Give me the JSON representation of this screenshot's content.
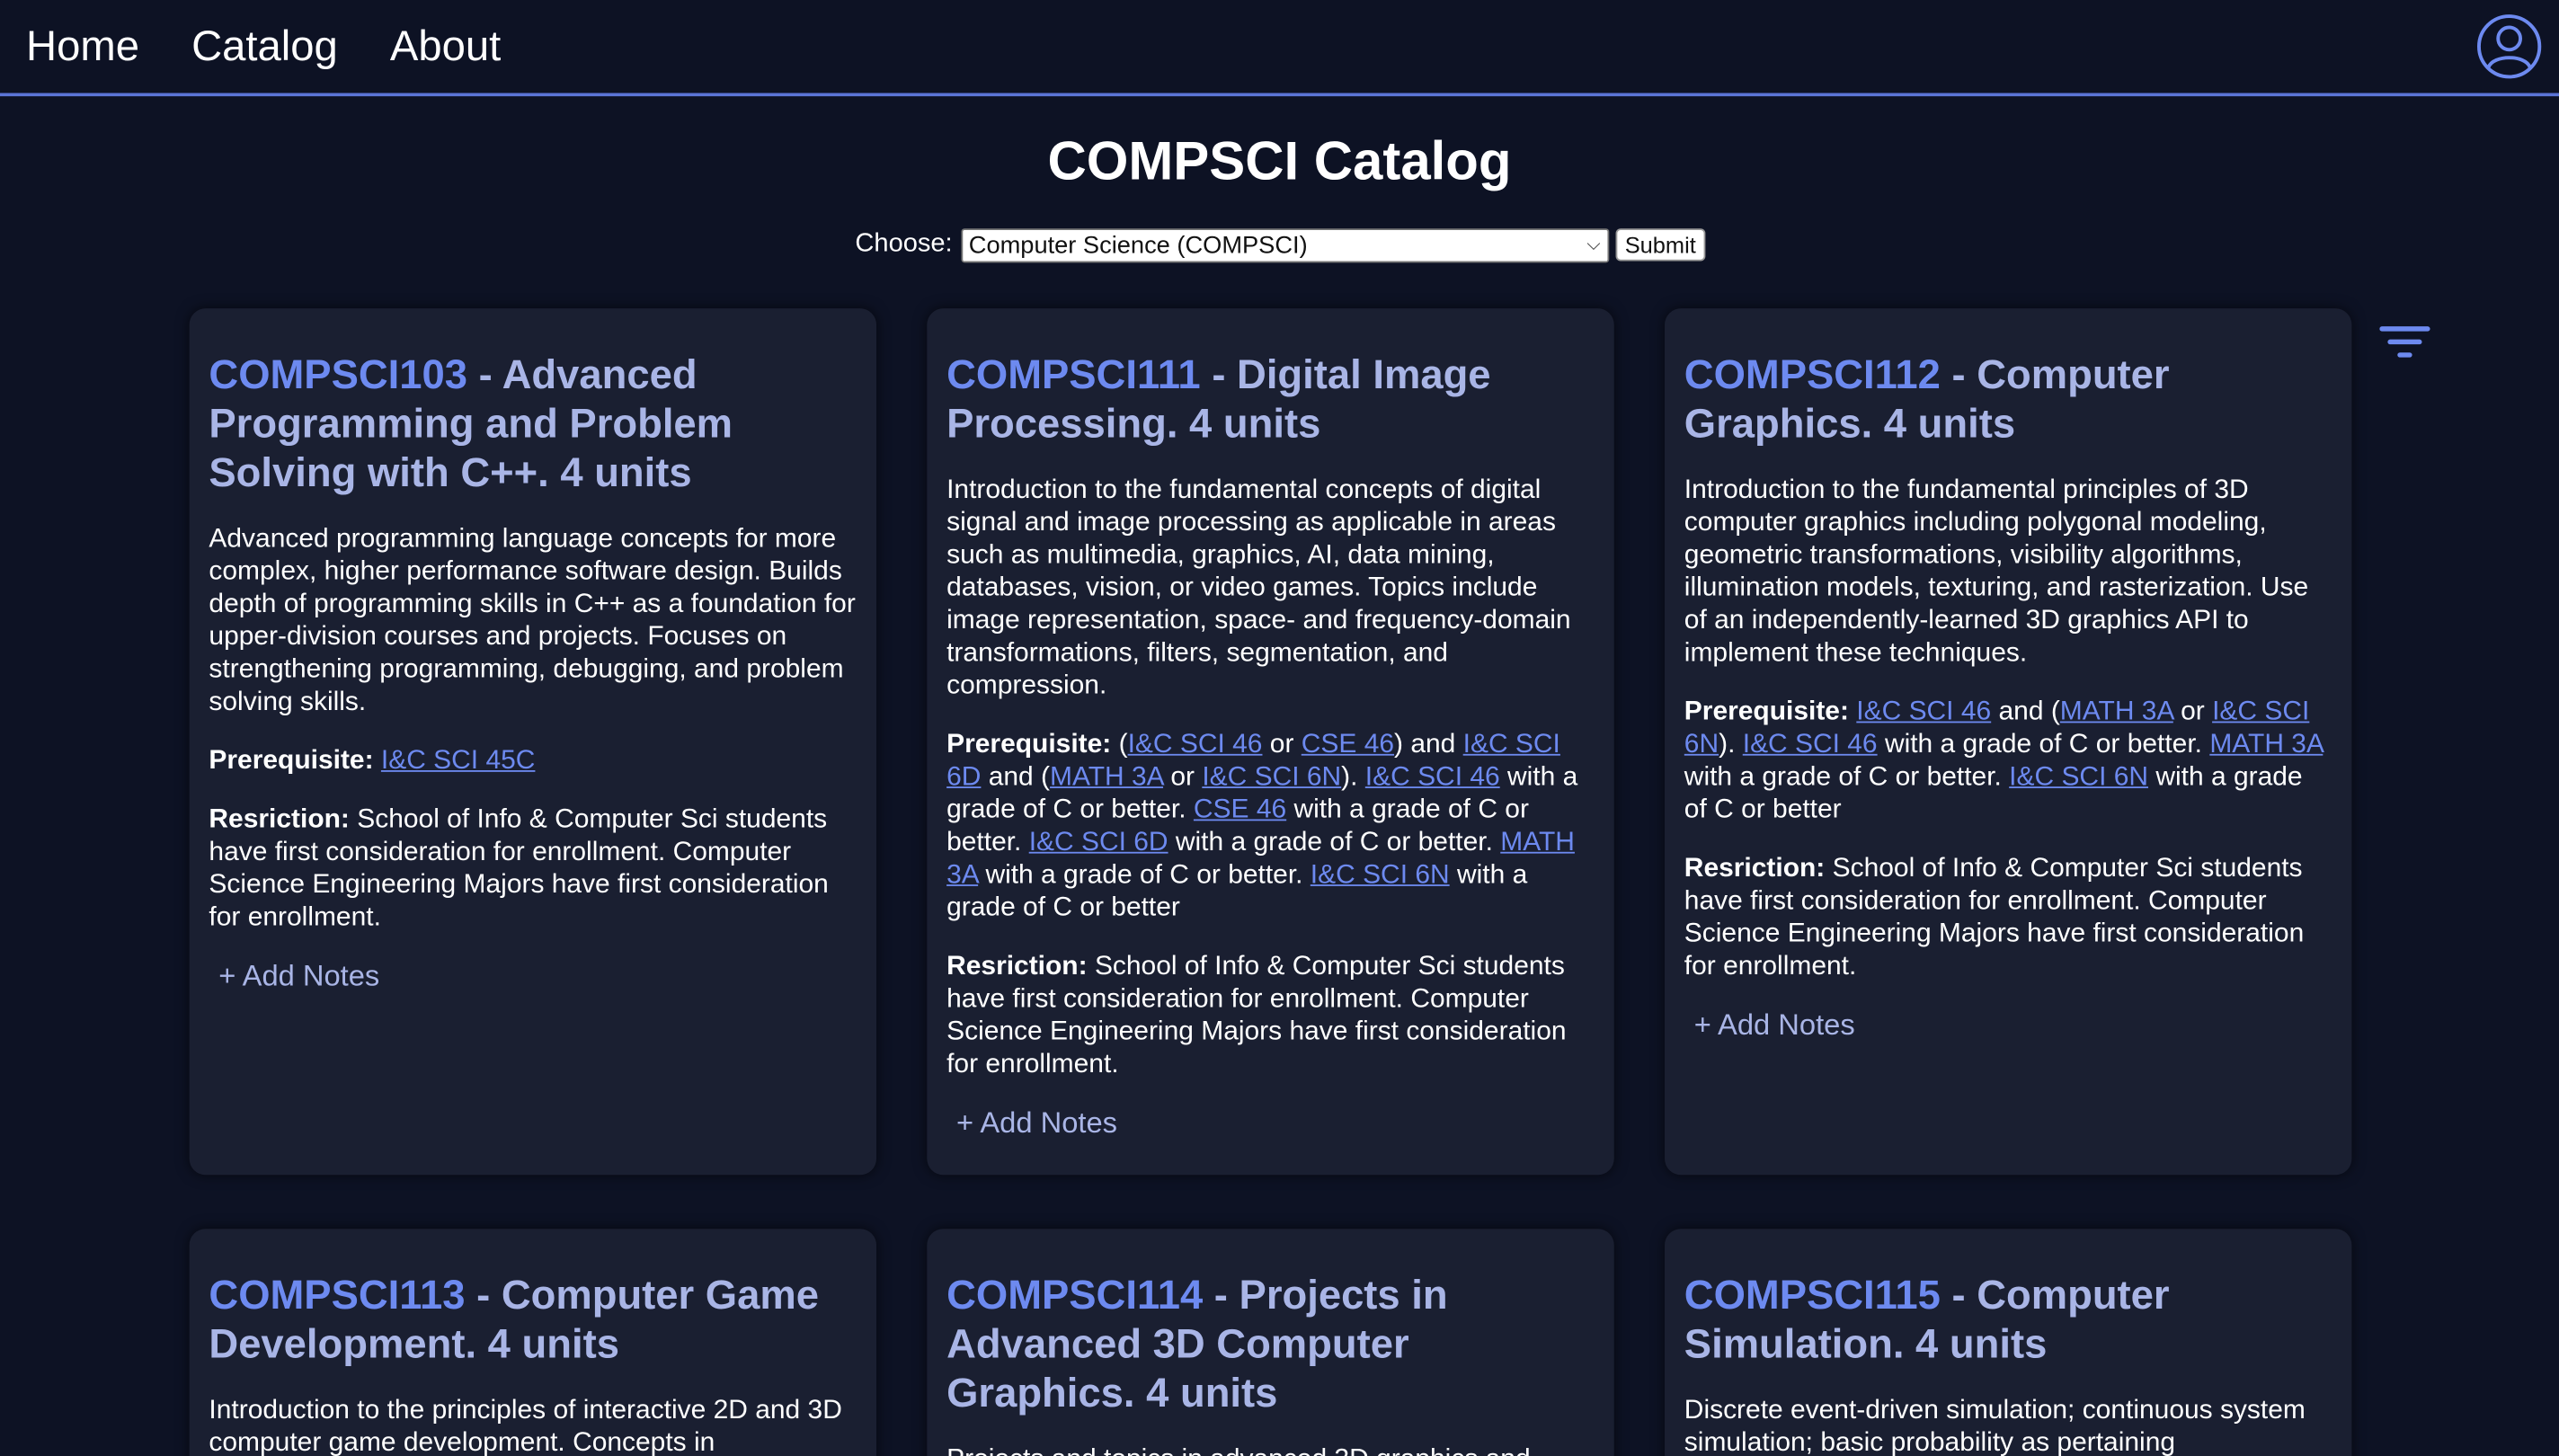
{
  "nav": {
    "home": "Home",
    "catalog": "Catalog",
    "about": "About"
  },
  "title": "COMPSCI Catalog",
  "chooser": {
    "label": "Choose:",
    "selected": "Computer Science (COMPSCI)",
    "submit": "Submit"
  },
  "labels": {
    "prereq": "Prerequisite:",
    "restr": "Resriction:",
    "add_notes": "+ Add Notes"
  },
  "restriction_text": "School of Info & Computer Sci students have first consideration for enrollment. Computer Science Engineering Majors have first consideration for enrollment.",
  "courses": [
    {
      "code": "COMPSCI103",
      "title": " - Advanced Programming and Problem Solving with C++. 4 units",
      "desc": "Advanced programming language concepts for more complex, higher performance software design. Builds depth of programming skills in C++ as a foundation for upper-division courses and projects. Focuses on strengthening programming, debugging, and problem solving skills.",
      "prereq": {
        "l1": "I&C SCI 45C"
      }
    },
    {
      "code": "COMPSCI111",
      "title": " - Digital Image Processing. 4 units",
      "desc": "Introduction to the fundamental concepts of digital signal and image processing as applicable in areas such as multimedia, graphics, AI, data mining, databases, vision, or video games. Topics include image representation, space- and frequency-domain transformations, filters, segmentation, and compression.",
      "prereq": {
        "t0": "(",
        "l1": "I&C SCI 46",
        "t1": " or ",
        "l2": "CSE 46",
        "t2": ") and ",
        "l3": "I&C SCI 6D",
        "t3": " and (",
        "l4": "MATH 3A",
        "t4": " or ",
        "l5": "I&C SCI 6N",
        "t5": "). ",
        "l6": "I&C SCI 46",
        "t6": " with a grade of C or better. ",
        "l7": "CSE 46",
        "t7": " with a grade of C or better. ",
        "l8": "I&C SCI 6D",
        "t8": " with a grade of C or better. ",
        "l9": "MATH 3A",
        "t9": " with a grade of C or better. ",
        "l10": "I&C SCI 6N",
        "t10": " with a grade of C or better"
      }
    },
    {
      "code": "COMPSCI112",
      "title": " - Computer Graphics. 4 units",
      "desc": "Introduction to the fundamental principles of 3D computer graphics including polygonal modeling, geometric transformations, visibility algorithms, illumination models, texturing, and rasterization. Use of an independently-learned 3D graphics API to implement these techniques.",
      "prereq": {
        "l1": "I&C SCI 46",
        "t1": " and (",
        "l2": "MATH 3A",
        "t2": " or ",
        "l3": "I&C SCI 6N",
        "t3": "). ",
        "l4": "I&C SCI 46",
        "t4": " with a grade of C or better. ",
        "l5": "MATH 3A",
        "t5": " with a grade of C or better. ",
        "l6": "I&C SCI 6N",
        "t6": " with a grade of C or better"
      }
    },
    {
      "code": "COMPSCI113",
      "title": " - Computer Game Development. 4 units",
      "desc": "Introduction to the principles of interactive 2D and 3D computer game development. Concepts in"
    },
    {
      "code": "COMPSCI114",
      "title": " - Projects in Advanced 3D Computer Graphics. 4 units",
      "desc": "Projects and topics in advanced 3D graphics and"
    },
    {
      "code": "COMPSCI115",
      "title": " - Computer Simulation. 4 units",
      "desc": "Discrete event-driven simulation; continuous system simulation; basic probability as pertaining"
    }
  ]
}
